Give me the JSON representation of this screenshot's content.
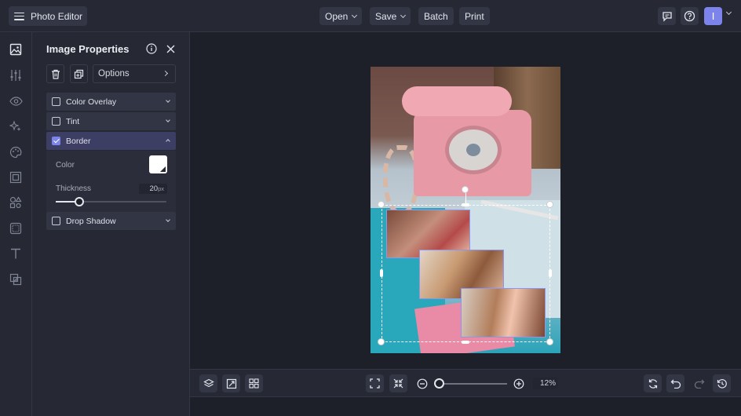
{
  "app": {
    "title": "Photo Editor"
  },
  "toolbar": {
    "open_label": "Open",
    "save_label": "Save",
    "batch_label": "Batch",
    "print_label": "Print",
    "user_initial": "I"
  },
  "rail": {
    "items": [
      "image-icon",
      "sliders-icon",
      "eye-icon",
      "sparkles-icon",
      "palette-icon",
      "frame-icon",
      "shapes-icon",
      "border-frame-icon",
      "text-icon",
      "overlay-icon"
    ]
  },
  "panel": {
    "title": "Image Properties",
    "options_label": "Options",
    "sections": [
      {
        "label": "Color Overlay",
        "checked": false,
        "expanded": false
      },
      {
        "label": "Tint",
        "checked": false,
        "expanded": false
      },
      {
        "label": "Border",
        "checked": true,
        "expanded": true
      },
      {
        "label": "Drop Shadow",
        "checked": false,
        "expanded": false
      }
    ],
    "border": {
      "color_label": "Color",
      "color_value": "#ffffff",
      "thickness_label": "Thickness",
      "thickness_value": "20",
      "thickness_unit": "px"
    }
  },
  "bottombar": {
    "zoom_value": "12",
    "zoom_unit": "%"
  },
  "colors": {
    "accent": "#7c83ea",
    "background": "#1d1f29",
    "panel": "#262834"
  }
}
